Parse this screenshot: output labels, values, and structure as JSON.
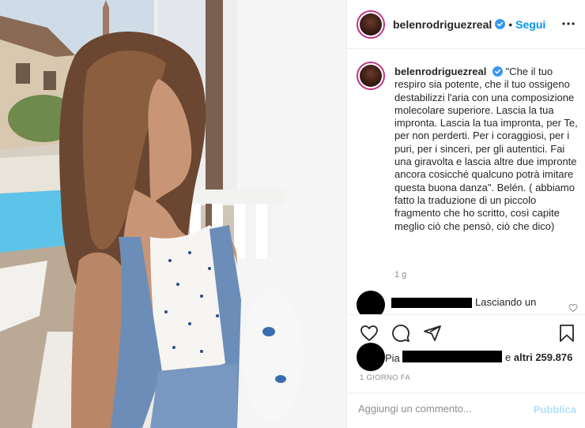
{
  "post": {
    "username": "belenrodriguezreal",
    "follow_label": "Segui",
    "dot": "•",
    "caption": "\"Che il tuo respiro sia potente, che il tuo ossigeno destabilizzi l'aria con una composizione molecolare superiore. Lascia la tua impronta. Lascia la tua impronta, per Te, per non perderti. Per i coraggiosi, per i puri, per i sinceri, per gli autentici. Fai una giravolta e lascia altre due impronte ancora cosicché qualcuno potrà imitare questa buona danza\". Belén. ( abbiamo fatto la traduzione di un piccolo fragmento che ho scritto, così capite meglio ciò che pensò, ciò che dico)",
    "caption_time": "1 g"
  },
  "comment": {
    "text": "Lasciando un"
  },
  "likes": {
    "prefix": "Pia",
    "conj": "e",
    "others": "altri 259.876"
  },
  "date": "1 GIORNO FA",
  "add_comment": {
    "placeholder": "Aggiungi un commento...",
    "publish_label": "Pubblica"
  },
  "icons": {
    "more": "more-horizontal-icon",
    "verified": "verified-badge-icon",
    "like": "heart-icon",
    "comment": "comment-bubble-icon",
    "share": "paper-plane-icon",
    "save": "bookmark-icon"
  },
  "colors": {
    "link_blue": "#0095f6",
    "publish_disabled": "#b2dffc",
    "meta_grey": "#8e8e8e",
    "text": "#262626"
  }
}
